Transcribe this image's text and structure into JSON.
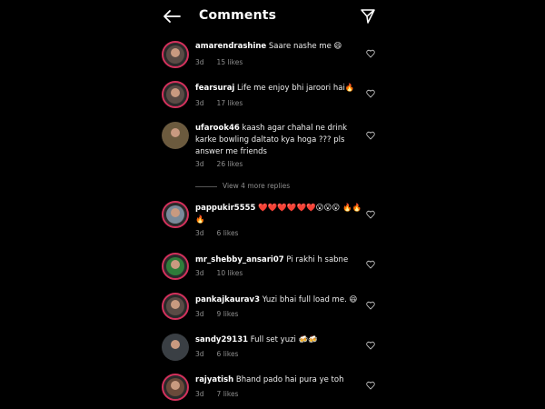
{
  "header": {
    "title": "Comments",
    "back_icon": "back-arrow-icon",
    "send_icon": "send-icon"
  },
  "comments": [
    {
      "username": "amarendrashine",
      "text": "Saare nashe me 😄",
      "time": "3d",
      "likes": "15 likes"
    },
    {
      "username": "fearsuraj",
      "text": "Life me enjoy bhi jaroori hai🔥",
      "time": "3d",
      "likes": "17 likes"
    },
    {
      "username": "ufarook46",
      "text": "kaash agar chahal ne drink karke bowling daltato kya hoga ??? pls answer me friends",
      "time": "3d",
      "likes": "26 likes"
    },
    {
      "username": "pappukir5555",
      "text": "❤️❤️❤️❤️❤️❤️😮😮😮 🔥🔥🔥",
      "time": "3d",
      "likes": "6 likes"
    },
    {
      "username": "mr_shebby_ansari07",
      "text": "Pi rakhi h sabne",
      "time": "3d",
      "likes": "10 likes"
    },
    {
      "username": "pankajkaurav3",
      "text": "Yuzi bhai full load me. 😆",
      "time": "3d",
      "likes": "9 likes"
    },
    {
      "username": "sandy29131",
      "text": "Full set yuzi 🍻🍻",
      "time": "3d",
      "likes": "6 likes"
    },
    {
      "username": "rajyatish",
      "text": "Bhand pado hai pura ye toh",
      "time": "3d",
      "likes": "7 likes"
    }
  ],
  "view_replies": "View 4 more replies",
  "colors": {
    "background": "#000000",
    "story_ring": "#d3315c",
    "meta": "#8e8e8e"
  }
}
